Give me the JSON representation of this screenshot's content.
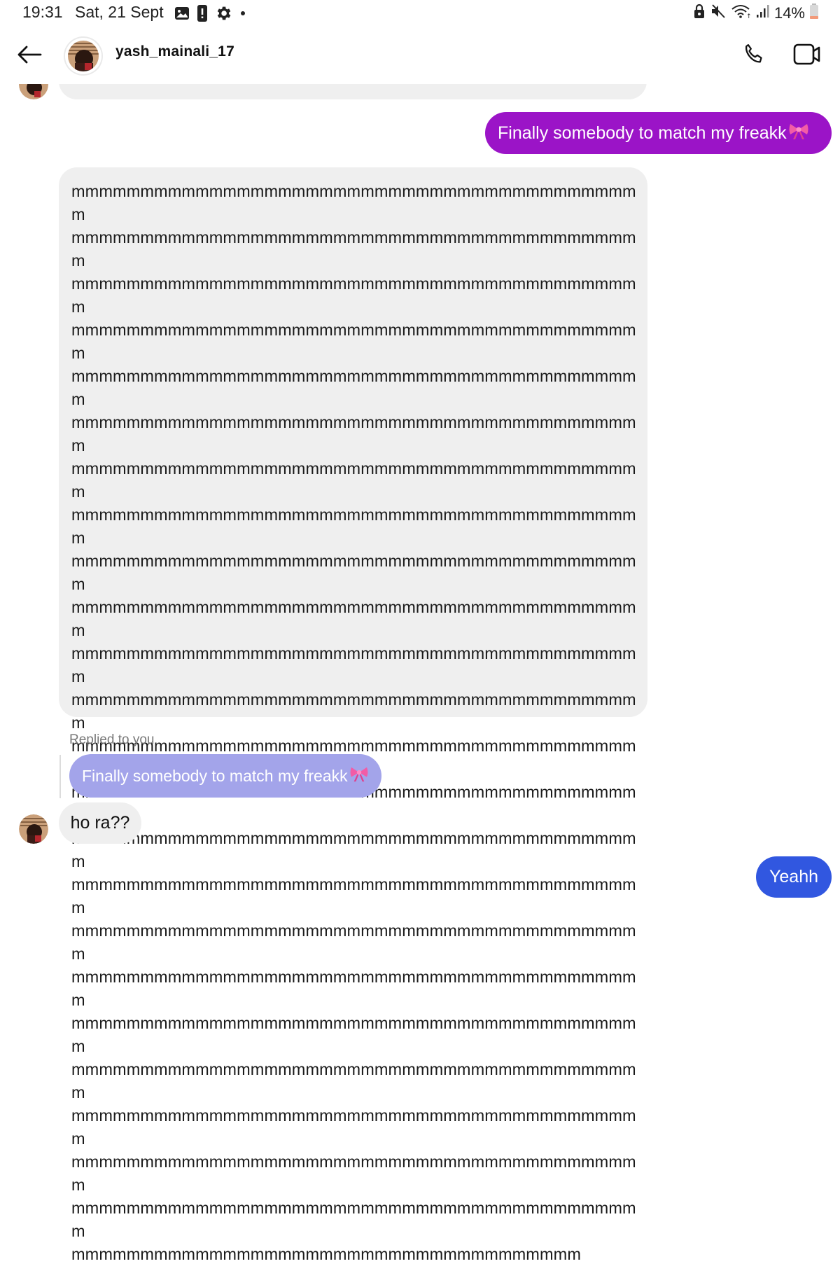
{
  "status_bar": {
    "time": "19:31",
    "date": "Sat, 21 Sept",
    "battery": "14%",
    "left_icons": [
      "gallery-icon",
      "alert-icon",
      "settings-gear-icon",
      "dot-icon"
    ],
    "right_icons": [
      "lock-icon",
      "mute-icon",
      "wifi-icon",
      "signal-icon",
      "battery-icon"
    ]
  },
  "header": {
    "username": "yash_mainali_17",
    "back_icon": "arrow-left-icon",
    "call_icon": "phone-icon",
    "video_icon": "video-camera-icon"
  },
  "messages": {
    "sent_1": {
      "text": "Finally somebody to match my freakk",
      "emoji": "ribbon-bow"
    },
    "received_long": {
      "lines": [
        "mmmmmmmmmmmmmmmmmmmmmmmmmmmmmmmmmmmmmmmmmm",
        "mmmmmmmmmmmmmmmmmmmmmmmmmmmmmmmmmmmmmmmmmm",
        "mmmmmmmmmmmmmmmmmmmmmmmmmmmmmmmmmmmmmmmmmm",
        "mmmmmmmmmmmmmmmmmmmmmmmmmmmmmmmmmmmmmmmmmm",
        "mmmmmmmmmmmmmmmmmmmmmmmmmmmmmmmmmmmmmmmmmm",
        "mmmmmmmmmmmmmmmmmmmmmmmmmmmmmmmmmmmmmmmmmm",
        "mmmmmmmmmmmmmmmmmmmmmmmmmmmmmmmmmmmmmmmmmm",
        "mmmmmmmmmmmmmmmmmmmmmmmmmmmmmmmmmmmmmmmmmm",
        "mmmmmmmmmmmmmmmmmmmmmmmmmmmmmmmmmmmmmmmmmm",
        "mmmmmmmmmmmmmmmmmmmmmmmmmmmmmmmmmmmmmmmmmm",
        "mmmmmmmmmmmmmmmmmmmmmmmmmmmmmmmmmmmmmmmmmm",
        "mmmmmmmmmmmmmmmmmmmmmmmmmmmmmmmmmmmmmmmmmm",
        "mmmmmmmmmmmmmmmmmmmmmmmmmmmmmmmmmmmmmmmmmm",
        "mmmmmmmmmmmmmmmmmmmmmmmmmmmmmmmmmmmmmmmmmm",
        "mmmmmmmmmmmmmmmmmmmmmmmmmmmmmmmmmmmmmmmmmm",
        "mmmmmmmmmmmmmmmmmmmmmmmmmmmmmmmmmmmmmmmmmm",
        "mmmmmmmmmmmmmmmmmmmmmmmmmmmmmmmmmmmmmmmmmm",
        "mmmmmmmmmmmmmmmmmmmmmmmmmmmmmmmmmmmmmmmmmm",
        "mmmmmmmmmmmmmmmmmmmmmmmmmmmmmmmmmmmmmmmmmm",
        "mmmmmmmmmmmmmmmmmmmmmmmmmmmmmmmmmmmmmmmmmm",
        "mmmmmmmmmmmmmmmmmmmmmmmmmmmmmmmmmmmmmmmmmm",
        "mmmmmmmmmmmmmmmmmmmmmmmmmmmmmmmmmmmmmmmmmm",
        "mmmmmmmmmmmmmmmmmmmmmmmmmmmmmmmmmmmmmmmmmm",
        "mmmmmmmmmmmmmmmmmmmmmmmmmmmmmmmmmmmmm"
      ]
    },
    "reply_context": "Replied to you",
    "reply_quote": {
      "text": "Finally somebody to match my freakk",
      "emoji": "ribbon-bow"
    },
    "received_short": {
      "text": "ho ra??"
    },
    "sent_2": {
      "text": "Yeahh"
    }
  },
  "colors": {
    "sent_purple": "#9b14c7",
    "sent_blue": "#3157e0",
    "reply_quote": "#a3a4ea",
    "received_bubble": "#efefef",
    "ribbon": "#f25ca6"
  }
}
